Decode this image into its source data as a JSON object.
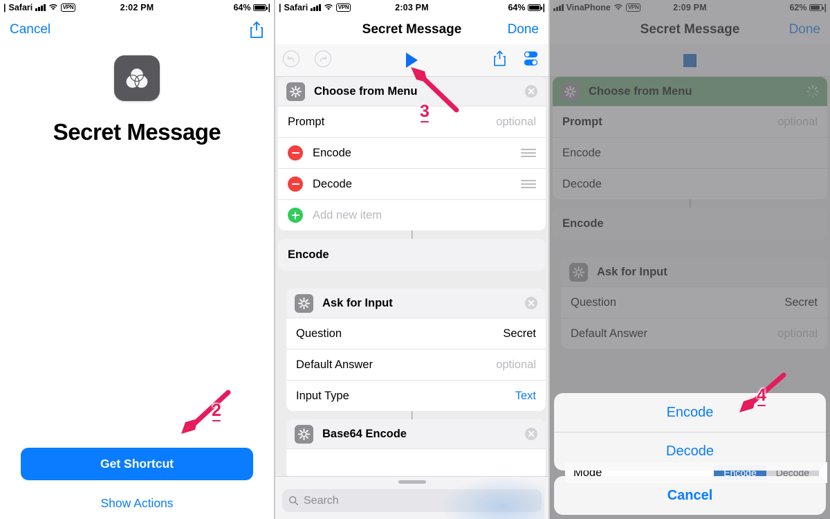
{
  "panels": [
    {
      "name": "get-shortcut-preview",
      "statusbar": {
        "pipe": "|",
        "carrier": "Safari",
        "vpn": "VPN",
        "time": "2:02 PM",
        "battery": "64%"
      },
      "navbar": {
        "left_label": "Cancel",
        "share_icon": "share-icon"
      },
      "app": {
        "icon": "venn-circles-icon",
        "title": "Secret Message"
      },
      "primary_button": "Get Shortcut",
      "secondary_link": "Show Actions"
    },
    {
      "name": "shortcut-editor",
      "statusbar": {
        "pipe": "|",
        "carrier": "Safari",
        "vpn": "VPN",
        "time": "2:03 PM",
        "battery": "64%"
      },
      "navbar": {
        "title": "Secret Message",
        "right_label": "Done"
      },
      "toolbar": {
        "undo_icon": "undo-icon",
        "redo_icon": "redo-icon",
        "play_icon": "play-icon",
        "share_icon": "share-icon",
        "settings_icon": "toggles-icon"
      },
      "menu_action": {
        "icon": "gear-icon",
        "title": "Choose from Menu",
        "close_icon": "close-icon",
        "prompt_label": "Prompt",
        "prompt_value": "optional",
        "items": [
          {
            "label": "Encode",
            "remove_icon": "minus-circle-icon",
            "drag_icon": "drag-handle-icon"
          },
          {
            "label": "Decode",
            "remove_icon": "minus-circle-icon",
            "drag_icon": "drag-handle-icon"
          }
        ],
        "add_item_label": "Add new item",
        "add_icon": "plus-circle-icon"
      },
      "branch_label": "Encode",
      "ask_action": {
        "icon": "gear-icon",
        "title": "Ask for Input",
        "close_icon": "close-icon",
        "rows": [
          {
            "label": "Question",
            "value": "Secret",
            "style": "value"
          },
          {
            "label": "Default Answer",
            "value": "optional",
            "style": "optional"
          },
          {
            "label": "Input Type",
            "value": "Text",
            "style": "blue"
          }
        ]
      },
      "base64_action": {
        "icon": "gear-icon",
        "title": "Base64 Encode",
        "close_icon": "close-icon"
      },
      "search": {
        "icon": "search-icon",
        "placeholder": "Search"
      }
    },
    {
      "name": "shortcut-running-menu",
      "statusbar": {
        "carrier": "VinaPhone",
        "vpn": "VPN",
        "time": "2:09 PM",
        "battery": "62%"
      },
      "navbar": {
        "title": "Secret Message",
        "right_label": "Done"
      },
      "toolbar": {
        "stop_icon": "stop-icon"
      },
      "menu_action": {
        "icon": "gear-icon",
        "title": "Choose from Menu",
        "spinner_icon": "spinner-icon",
        "prompt_label": "Prompt",
        "prompt_value": "optional",
        "items": [
          {
            "label": "Encode"
          },
          {
            "label": "Decode"
          }
        ]
      },
      "branch_label": "Encode",
      "ask_action": {
        "icon": "gear-icon",
        "title": "Ask for Input",
        "rows": [
          {
            "label": "Question",
            "value": "Secret",
            "style": "value"
          },
          {
            "label": "Default Answer",
            "value": "optional",
            "style": "optional"
          }
        ]
      },
      "mode_row": {
        "label": "Mode",
        "segments": [
          "Encode",
          "Decode"
        ],
        "selected": 0
      },
      "action_sheet": {
        "options": [
          "Encode",
          "Decode"
        ],
        "cancel": "Cancel"
      }
    }
  ],
  "annotations": [
    {
      "number": "2",
      "target": "get-shortcut-button"
    },
    {
      "number": "3",
      "target": "play-button"
    },
    {
      "number": "4",
      "target": "encode-sheet-option"
    }
  ],
  "colors": {
    "accent_blue": "#0a7cff",
    "play_blue": "#0a6ff5",
    "running_green": "#6da571",
    "delete_red": "#f43f3f",
    "add_green": "#2fcd5a",
    "annotation_pink": "#e51b5c",
    "app_icon_gray": "#58585c"
  }
}
